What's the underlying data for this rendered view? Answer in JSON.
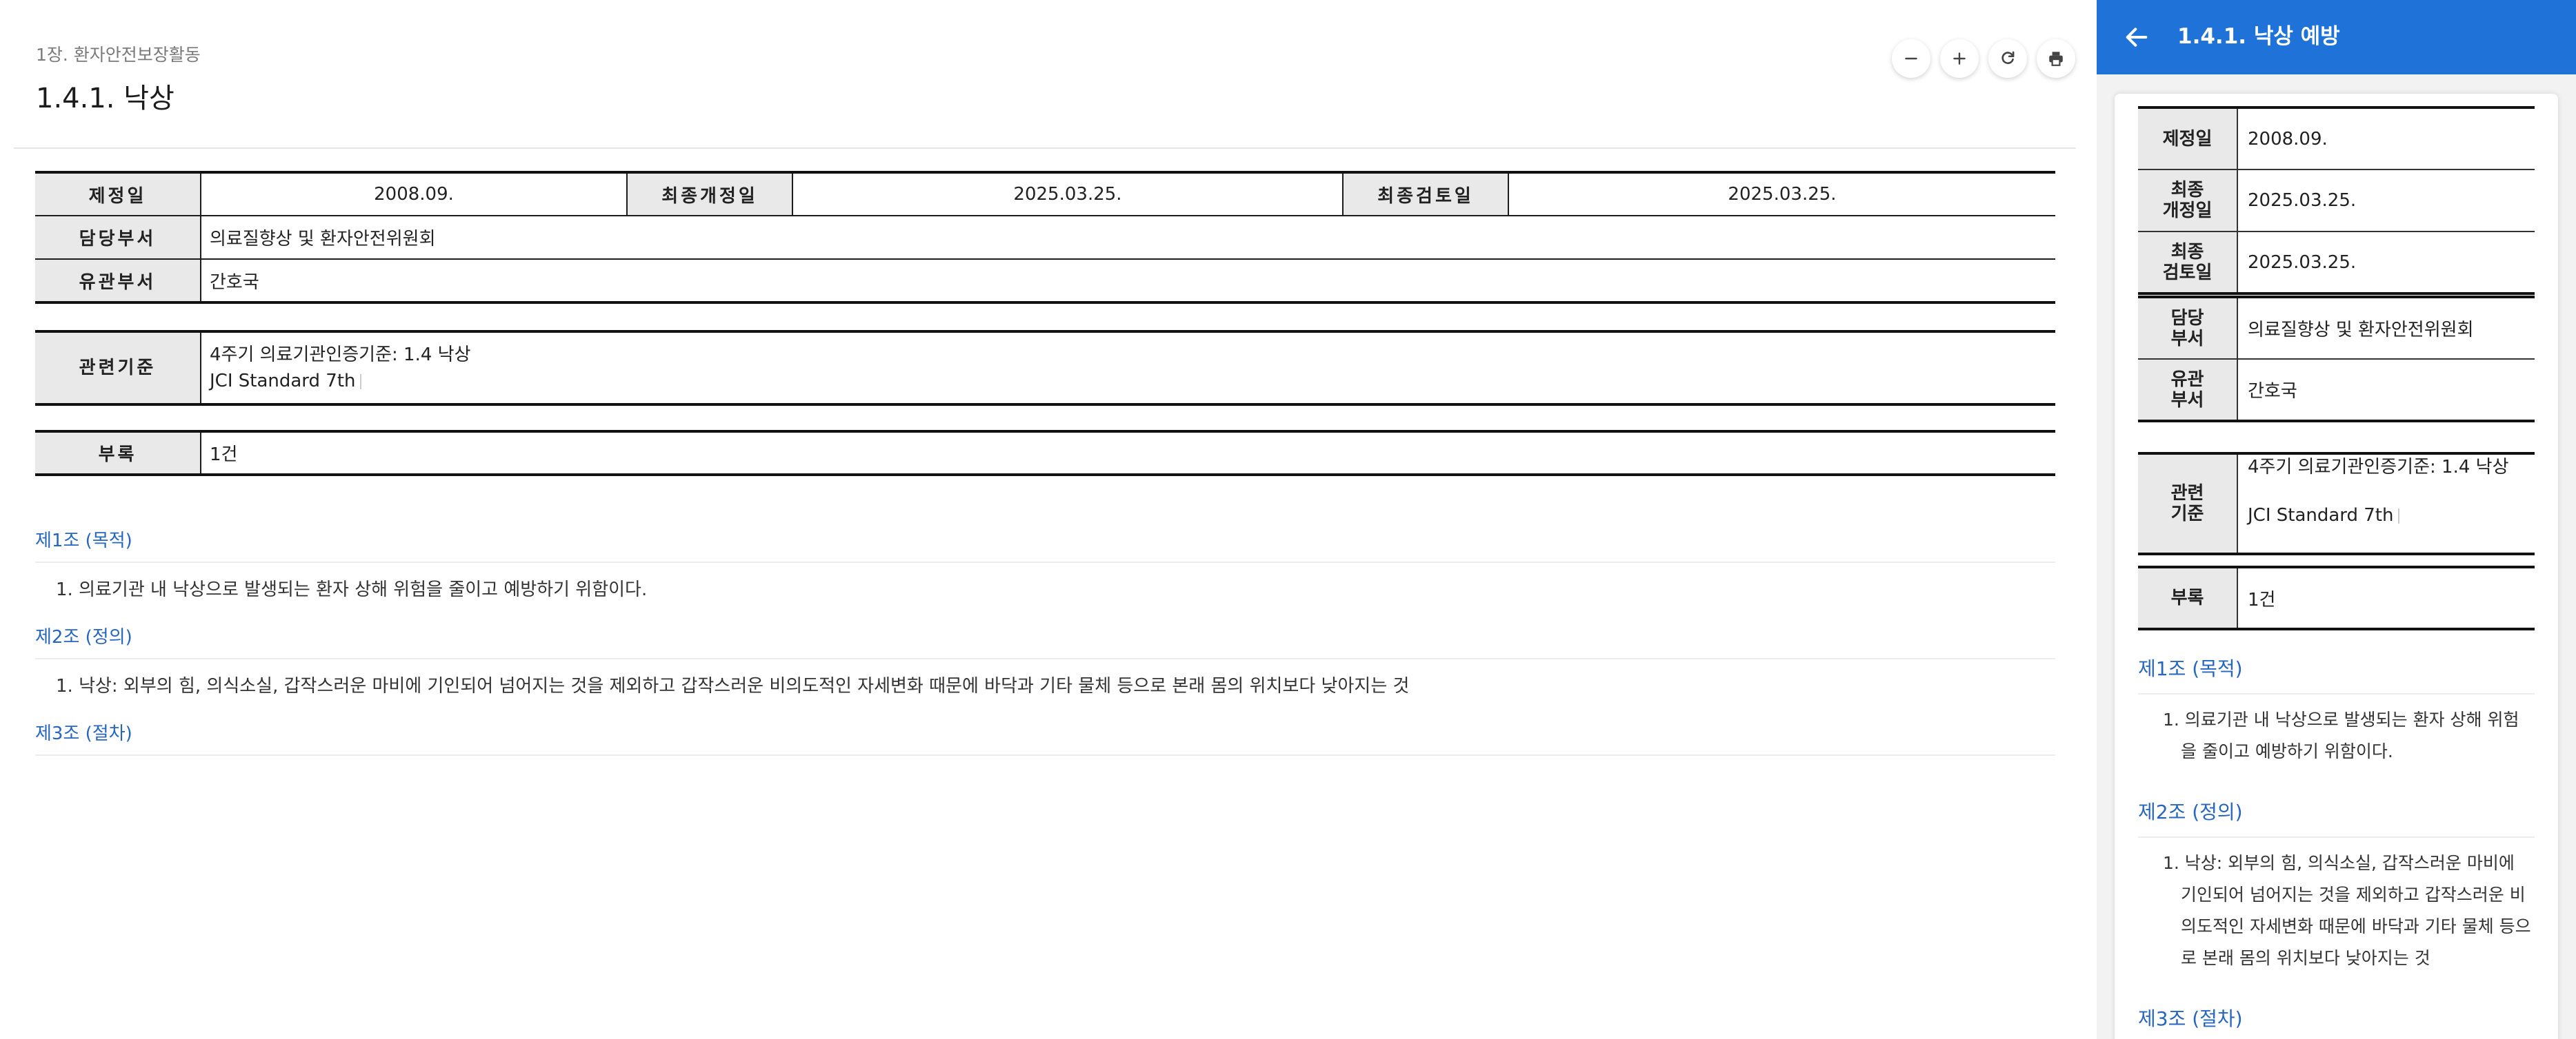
{
  "main": {
    "chapter": "1장. 환자안전보장활동",
    "title": "1.4.1. 낙상",
    "toolbar": {
      "zoom_out_icon": "minus-icon",
      "zoom_in_icon": "plus-icon",
      "refresh_icon": "refresh-icon",
      "print_icon": "printer-icon"
    },
    "info": {
      "enact_label": "제정일",
      "enact_value": "2008.09.",
      "revised_label": "최종개정일",
      "revised_value": "2025.03.25.",
      "reviewed_label": "최종검토일",
      "reviewed_value": "2025.03.25.",
      "dept_label": "담당부서",
      "dept_value": "의료질향상 및 환자안전위원회",
      "related_dept_label": "유관부서",
      "related_dept_value": "간호국",
      "standard_label": "관련기준",
      "standard_line1": "4주기 의료기관인증기준: 1.4 낙상",
      "standard_line2": "JCI Standard 7th",
      "appendix_label": "부록",
      "appendix_value": "1건"
    },
    "articles": [
      {
        "title": "제1조 (목적)",
        "item": "1. 의료기관 내 낙상으로 발생되는 환자 상해 위험을 줄이고 예방하기 위함이다."
      },
      {
        "title": "제2조 (정의)",
        "item": "1. 낙상: 외부의 힘, 의식소실, 갑작스러운 마비에 기인되어 넘어지는 것을 제외하고 갑작스러운 비의도적인 자세변화 때문에 바닥과 기타 물체 등으로 본래 몸의 위치보다 낮아지는 것"
      },
      {
        "title": "제3조 (절차)"
      }
    ]
  },
  "side": {
    "title": "1.4.1. 낙상 예방",
    "back_icon": "arrow-left-icon",
    "info": {
      "enact_label": "제정일",
      "enact_value": "2008.09.",
      "revised_label_1": "최종",
      "revised_label_2": "개정일",
      "revised_value": "2025.03.25.",
      "reviewed_label_1": "최종",
      "reviewed_label_2": "검토일",
      "reviewed_value": "2025.03.25.",
      "dept_label_1": "담당",
      "dept_label_2": "부서",
      "dept_value": "의료질향상 및 환자안전위원회",
      "related_dept_label_1": "유관",
      "related_dept_label_2": "부서",
      "related_dept_value": "간호국",
      "standard_label_1": "관련",
      "standard_label_2": "기준",
      "standard_line1": "4주기 의료기관인증기준: 1.4 낙상",
      "standard_line2": "JCI Standard 7th",
      "appendix_label": "부록",
      "appendix_value": "1건"
    },
    "articles": [
      {
        "title": "제1조 (목적)",
        "item": "1. 의료기관 내 낙상으로 발생되는 환자 상해 위험을 줄이고 예방하기 위함이다."
      },
      {
        "title": "제2조 (정의)",
        "item": "1. 낙상: 외부의 힘, 의식소실, 갑작스러운 마비에 기인되어 넘어지는 것을 제외하고 갑작스러운 비의도적인 자세변화 때문에 바닥과 기타 물체 등으로 본래 몸의 위치보다 낮아지는 것"
      },
      {
        "title": "제3조 (절차)"
      }
    ]
  },
  "colors": {
    "accent": "#1f73d8",
    "article_title": "#2766c0",
    "label_bg": "#e9e9e9"
  }
}
